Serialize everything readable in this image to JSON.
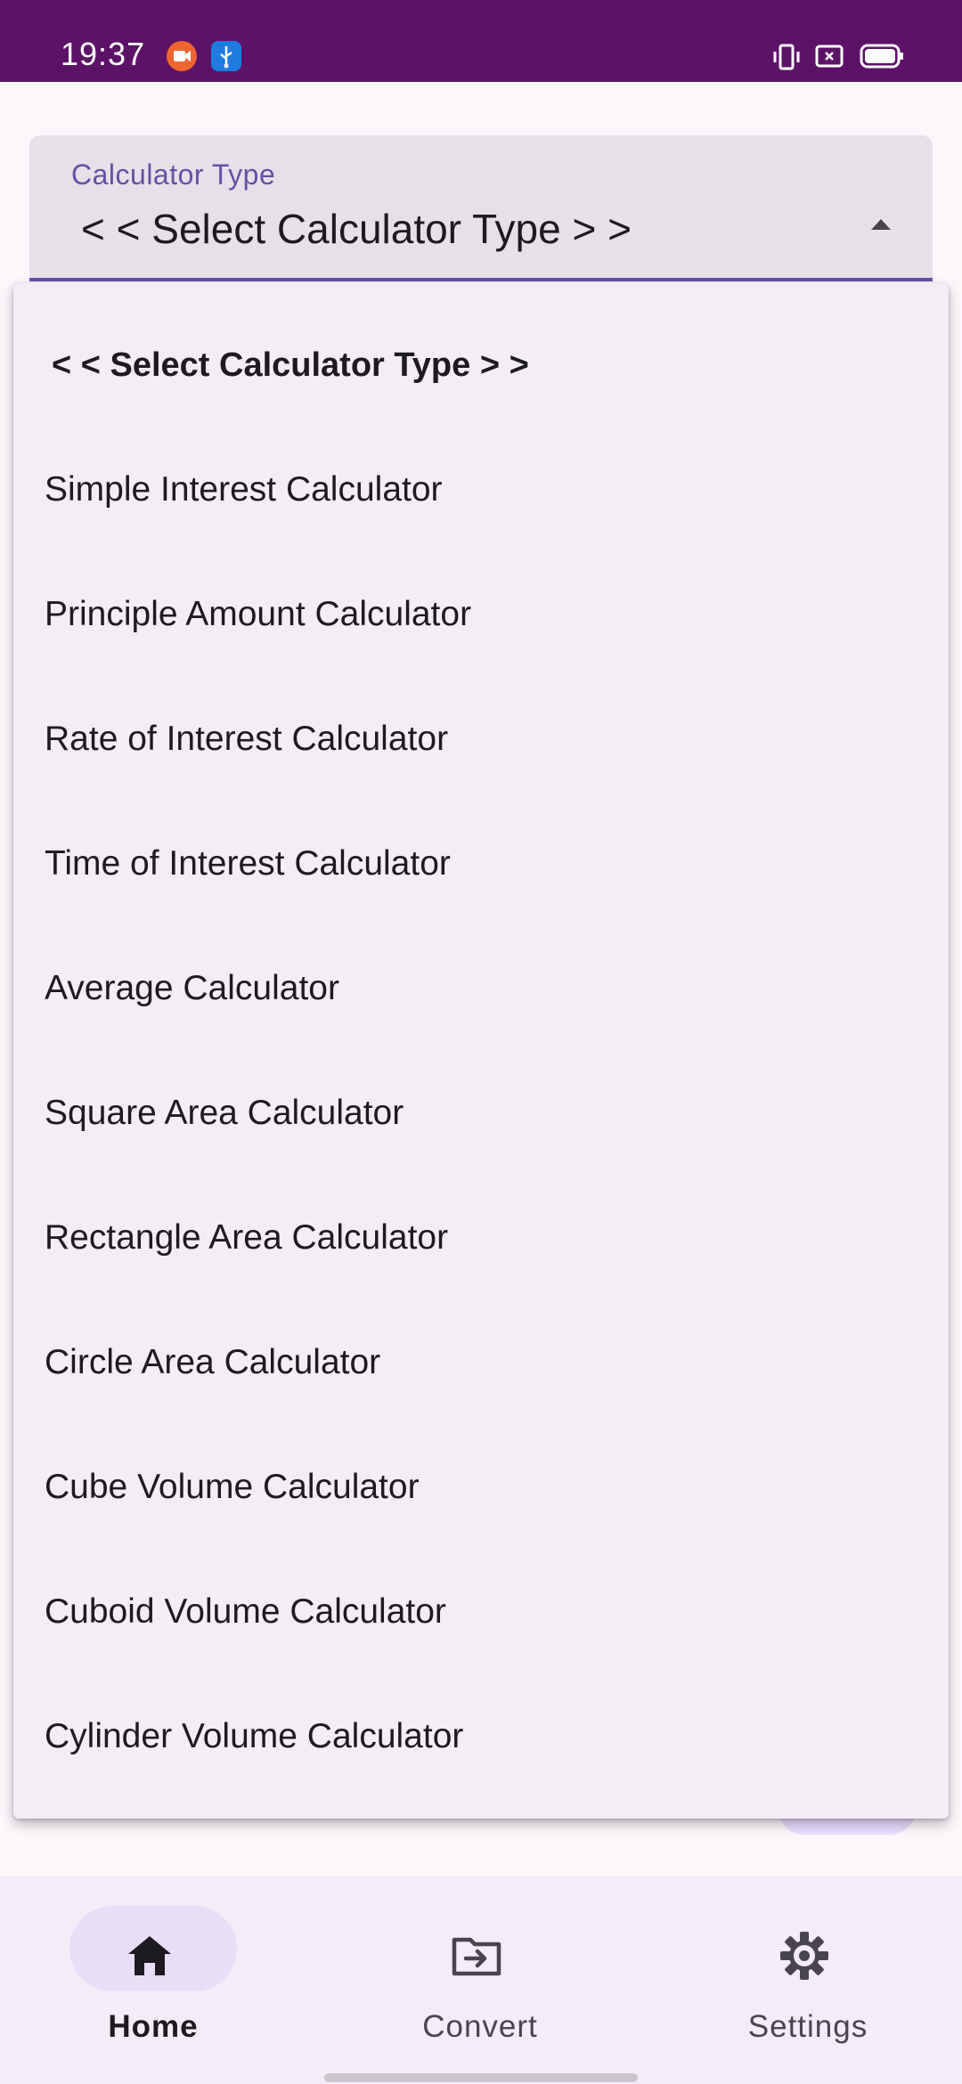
{
  "status_bar": {
    "time": "19:37",
    "icons": [
      "screen-record-icon",
      "usb-icon",
      "vibrate-icon",
      "nfc-icon",
      "battery-icon"
    ],
    "color": "#5c1367"
  },
  "calculator_field": {
    "label": "Calculator Type",
    "value": "< < Select Calculator Type > >",
    "expanded": true
  },
  "menu": {
    "items": [
      "< < Select Calculator Type > >",
      "Simple Interest Calculator",
      "Principle Amount Calculator",
      "Rate of Interest Calculator",
      "Time of Interest Calculator",
      "Average Calculator",
      "Square Area Calculator",
      "Rectangle Area Calculator",
      "Circle Area Calculator",
      "Cube Volume Calculator",
      "Cuboid Volume Calculator",
      "Cylinder Volume Calculator"
    ]
  },
  "bottom_nav": {
    "items": [
      {
        "label": "Home",
        "icon": "home-icon",
        "active": true
      },
      {
        "label": "Convert",
        "icon": "folder-convert-icon",
        "active": false
      },
      {
        "label": "Settings",
        "icon": "gear-icon",
        "active": false
      }
    ]
  },
  "colors": {
    "accent": "#6750a4",
    "nav_active_pill": "#e8def8",
    "menu_background": "#f3edf5"
  }
}
